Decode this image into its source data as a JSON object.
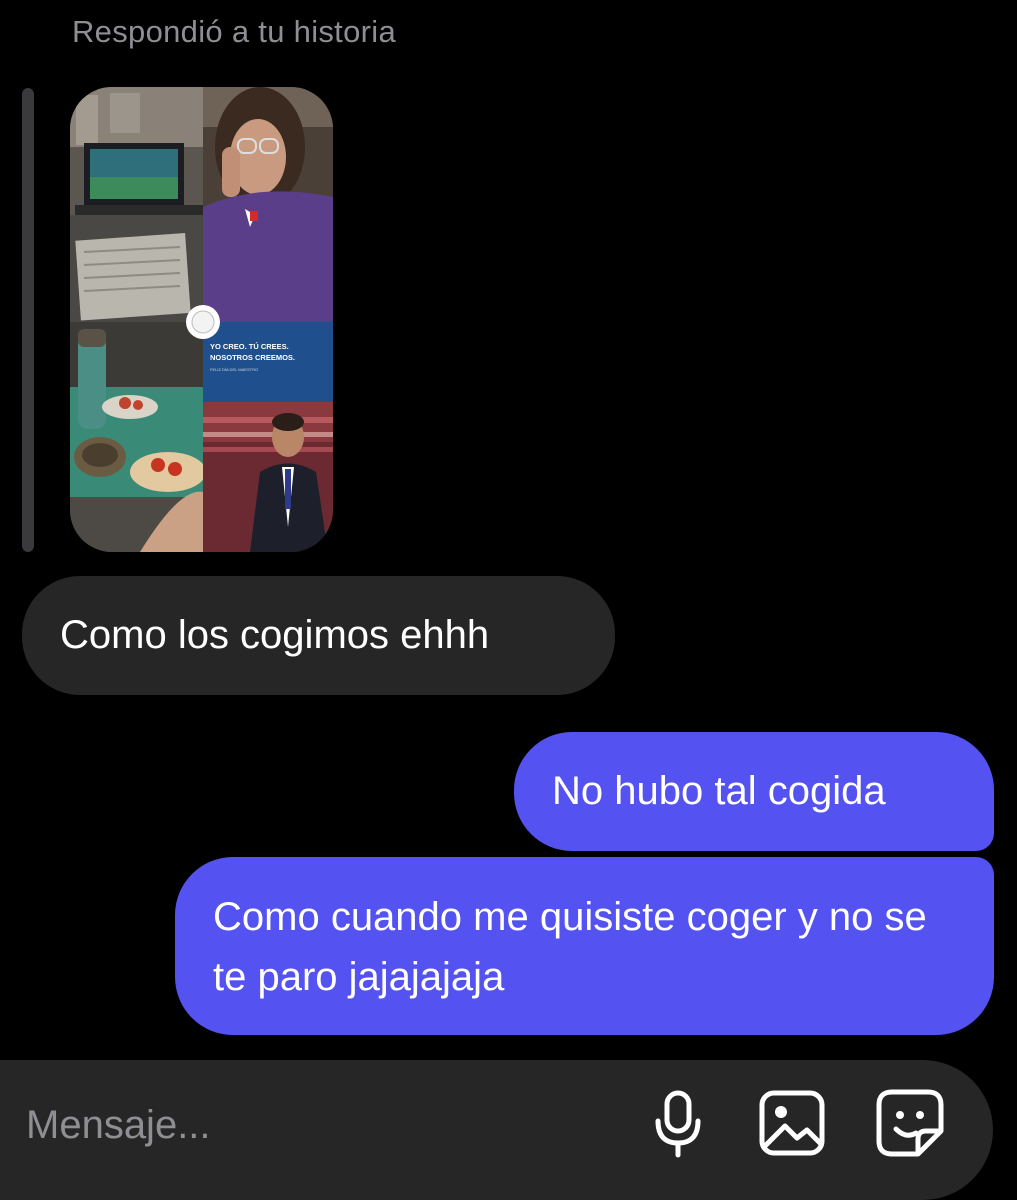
{
  "thread": {
    "story_reply_caption": "Respondió a tu historia"
  },
  "story": {
    "graphic_line1": "YO CREO. TÚ CREES.",
    "graphic_line2": "NOSOTROS CREEMOS.",
    "graphic_line3": "FELIZ DÍA DEL MAESTRO"
  },
  "messages": [
    {
      "direction": "incoming",
      "text": "Como los cogimos ehhh"
    },
    {
      "direction": "outgoing",
      "text": "No hubo tal cogida"
    },
    {
      "direction": "outgoing",
      "text": "Como cuando me quisiste coger y no se te paro jajajajaja"
    }
  ],
  "composer": {
    "placeholder": "Mensaje...",
    "icons": [
      "microphone-icon",
      "image-icon",
      "sticker-icon"
    ]
  },
  "colors": {
    "background": "#000000",
    "incoming_bubble": "#262626",
    "outgoing_bubble": "#5452f1",
    "muted_text": "#8e8e93"
  }
}
